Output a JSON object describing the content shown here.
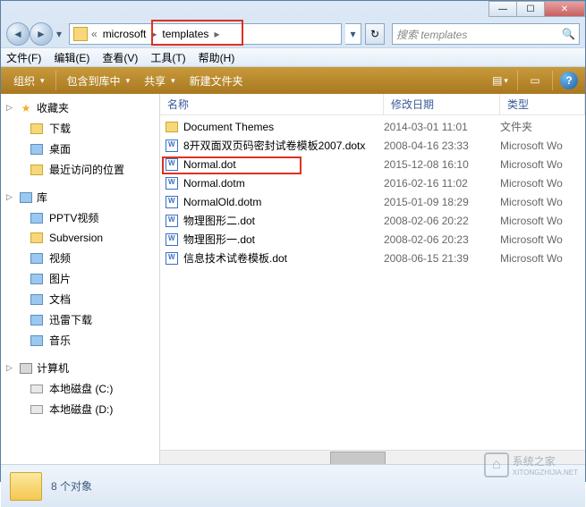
{
  "window": {
    "min": "—",
    "max": "☐",
    "close": "✕"
  },
  "nav": {
    "back": "◄",
    "fwd": "►",
    "dd": "▾"
  },
  "address": {
    "ellipsis": "«",
    "seg1": "microsoft",
    "seg2": "templates",
    "chev": "▸",
    "dropdown": "▾",
    "refresh": "↻"
  },
  "search": {
    "placeholder": "搜索 templates",
    "icon": "🔍"
  },
  "menu": {
    "file": "文件(F)",
    "edit": "编辑(E)",
    "view": "查看(V)",
    "tools": "工具(T)",
    "help": "帮助(H)"
  },
  "toolbar": {
    "organize": "组织",
    "include": "包含到库中",
    "share": "共享",
    "newfolder": "新建文件夹",
    "dd": "▾",
    "viewicon": "▤",
    "helpicon": "?"
  },
  "sidebar": {
    "fav": {
      "label": "收藏夹",
      "twisty": "▷"
    },
    "fav_items": [
      {
        "label": "下载"
      },
      {
        "label": "桌面"
      },
      {
        "label": "最近访问的位置"
      }
    ],
    "lib": {
      "label": "库",
      "twisty": "▷"
    },
    "lib_items": [
      {
        "label": "PPTV视频"
      },
      {
        "label": "Subversion"
      },
      {
        "label": "视频"
      },
      {
        "label": "图片"
      },
      {
        "label": "文档"
      },
      {
        "label": "迅雷下载"
      },
      {
        "label": "音乐"
      }
    ],
    "comp": {
      "label": "计算机",
      "twisty": "▷"
    },
    "comp_items": [
      {
        "label": "本地磁盘 (C:)"
      },
      {
        "label": "本地磁盘 (D:)"
      }
    ]
  },
  "columns": {
    "name": "名称",
    "date": "修改日期",
    "type": "类型"
  },
  "files": [
    {
      "name": "Document Themes",
      "date": "2014-03-01 11:01",
      "type": "文件夹",
      "kind": "folder"
    },
    {
      "name": "8开双面双页码密封试卷模板2007.dotx",
      "date": "2008-04-16 23:33",
      "type": "Microsoft Wo",
      "kind": "doc"
    },
    {
      "name": "Normal.dot",
      "date": "2015-12-08 16:10",
      "type": "Microsoft Wo",
      "kind": "doc"
    },
    {
      "name": "Normal.dotm",
      "date": "2016-02-16 11:02",
      "type": "Microsoft Wo",
      "kind": "doc"
    },
    {
      "name": "NormalOld.dotm",
      "date": "2015-01-09 18:29",
      "type": "Microsoft Wo",
      "kind": "doc"
    },
    {
      "name": "物理图形二.dot",
      "date": "2008-02-06 20:22",
      "type": "Microsoft Wo",
      "kind": "doc"
    },
    {
      "name": "物理图形一.dot",
      "date": "2008-02-06 20:23",
      "type": "Microsoft Wo",
      "kind": "doc"
    },
    {
      "name": "信息技术试卷模板.dot",
      "date": "2008-06-15 21:39",
      "type": "Microsoft Wo",
      "kind": "doc"
    }
  ],
  "status": {
    "text": "8 个对象"
  },
  "watermark": {
    "text": "系统之家",
    "sub": "XITONGZHIJIA.NET"
  }
}
